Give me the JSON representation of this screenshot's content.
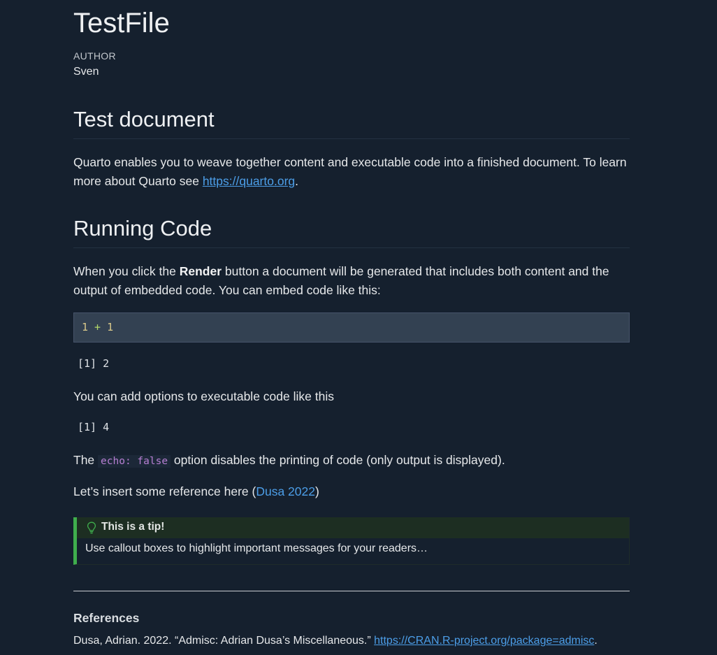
{
  "header": {
    "title": "TestFile",
    "author_label": "AUTHOR",
    "author_name": "Sven"
  },
  "section1": {
    "heading": "Test document",
    "para_text": "Quarto enables you to weave together content and executable code into a finished document. To learn more about Quarto see ",
    "link_text": "https://quarto.org",
    "para_end": "."
  },
  "section2": {
    "heading": "Running Code",
    "para_before": "When you click the ",
    "para_bold": "Render",
    "para_after": " button a document will be generated that includes both content and the output of embedded code. You can embed code like this:",
    "code": {
      "lhs": "1",
      "op": " + ",
      "rhs": "1"
    },
    "output1": "[1] 2",
    "options_text": "You can add options to executable code like this",
    "output2": "[1] 4",
    "echo_before": "The ",
    "echo_code": "echo: false",
    "echo_after": " option disables the printing of code (only output is displayed).",
    "ref_before": "Let’s insert some reference here (",
    "ref_link": "Dusa 2022",
    "ref_after": ")"
  },
  "callout": {
    "title": "This is a tip!",
    "body": "Use callout boxes to highlight important messages for your readers…",
    "icon": "lightbulb-icon",
    "accent_color": "#3fae4d"
  },
  "references": {
    "heading": "References",
    "entry_text": "Dusa, Adrian. 2022. “Admisc: Adrian Dusa’s Miscellaneous.” ",
    "entry_link": "https://CRAN.R-project.org/package=admisc",
    "entry_end": "."
  },
  "colors": {
    "background": "#15202e",
    "link": "#4c9ee8",
    "inline_code": "#b77fd3"
  }
}
